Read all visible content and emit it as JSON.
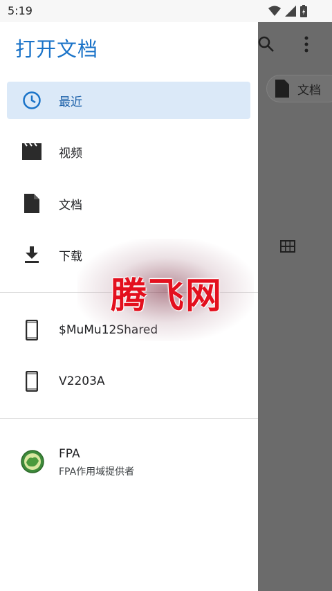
{
  "status_bar": {
    "time": "5:19"
  },
  "drawer": {
    "title": "打开文档",
    "items": [
      {
        "label": "最近",
        "icon": "clock-icon",
        "active": true
      },
      {
        "label": "视频",
        "icon": "video-icon",
        "active": false
      },
      {
        "label": "文档",
        "icon": "document-icon",
        "active": false
      },
      {
        "label": "下载",
        "icon": "download-icon",
        "active": false
      }
    ],
    "roots": [
      {
        "title": "$MuMu12Shared",
        "icon": "phone-icon"
      },
      {
        "title": "V2203A",
        "icon": "phone-icon"
      }
    ],
    "providers": [
      {
        "title": "FPA",
        "subtitle": "FPA作用域提供者",
        "icon": "fpa-logo-icon"
      }
    ]
  },
  "underlay": {
    "chip_label": "文档"
  },
  "watermark": {
    "text": "腾飞网"
  },
  "colors": {
    "accent": "#1a73c8",
    "active_bg": "#dbe9f8",
    "scrim": "#6b6b6b",
    "watermark": "#e3101e"
  }
}
